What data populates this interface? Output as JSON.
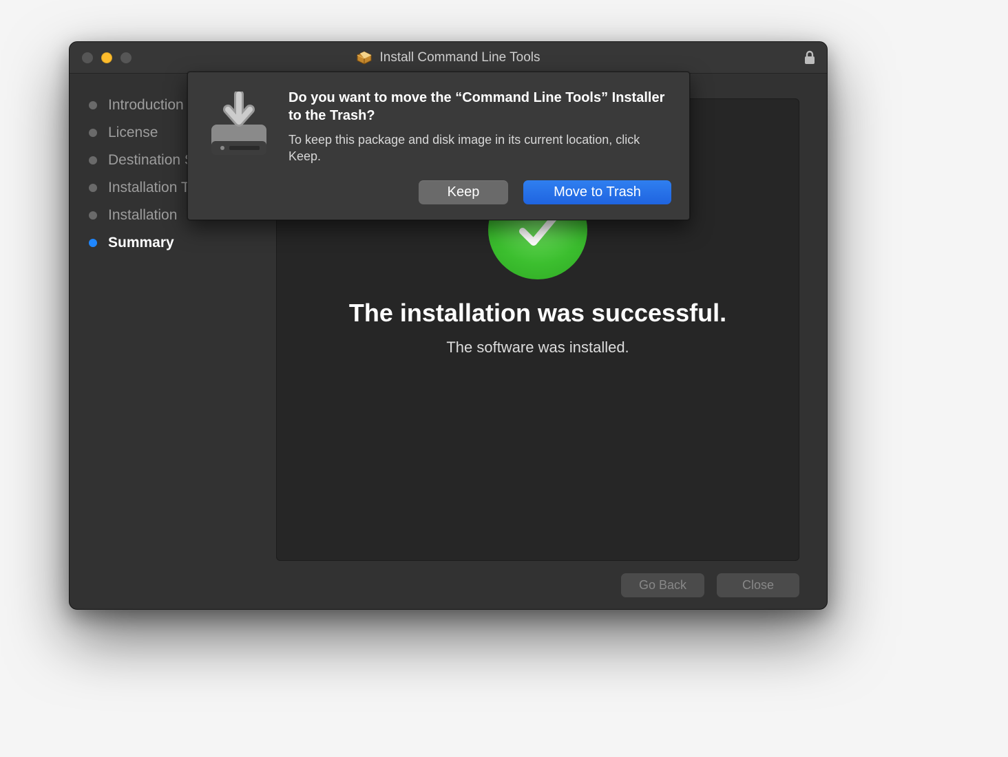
{
  "window": {
    "title": "Install Command Line Tools"
  },
  "sidebar": {
    "steps": [
      {
        "label": "Introduction",
        "active": false
      },
      {
        "label": "License",
        "active": false
      },
      {
        "label": "Destination Select",
        "active": false
      },
      {
        "label": "Installation Type",
        "active": false
      },
      {
        "label": "Installation",
        "active": false
      },
      {
        "label": "Summary",
        "active": true
      }
    ]
  },
  "content": {
    "success_title": "The installation was successful.",
    "success_subtitle": "The software was installed."
  },
  "footer": {
    "back_label": "Go Back",
    "close_label": "Close"
  },
  "dialog": {
    "heading": "Do you want to move the “Command Line Tools” Installer to the Trash?",
    "description": "To keep this package and disk image in its current location, click Keep.",
    "keep_label": "Keep",
    "move_label": "Move to Trash"
  }
}
